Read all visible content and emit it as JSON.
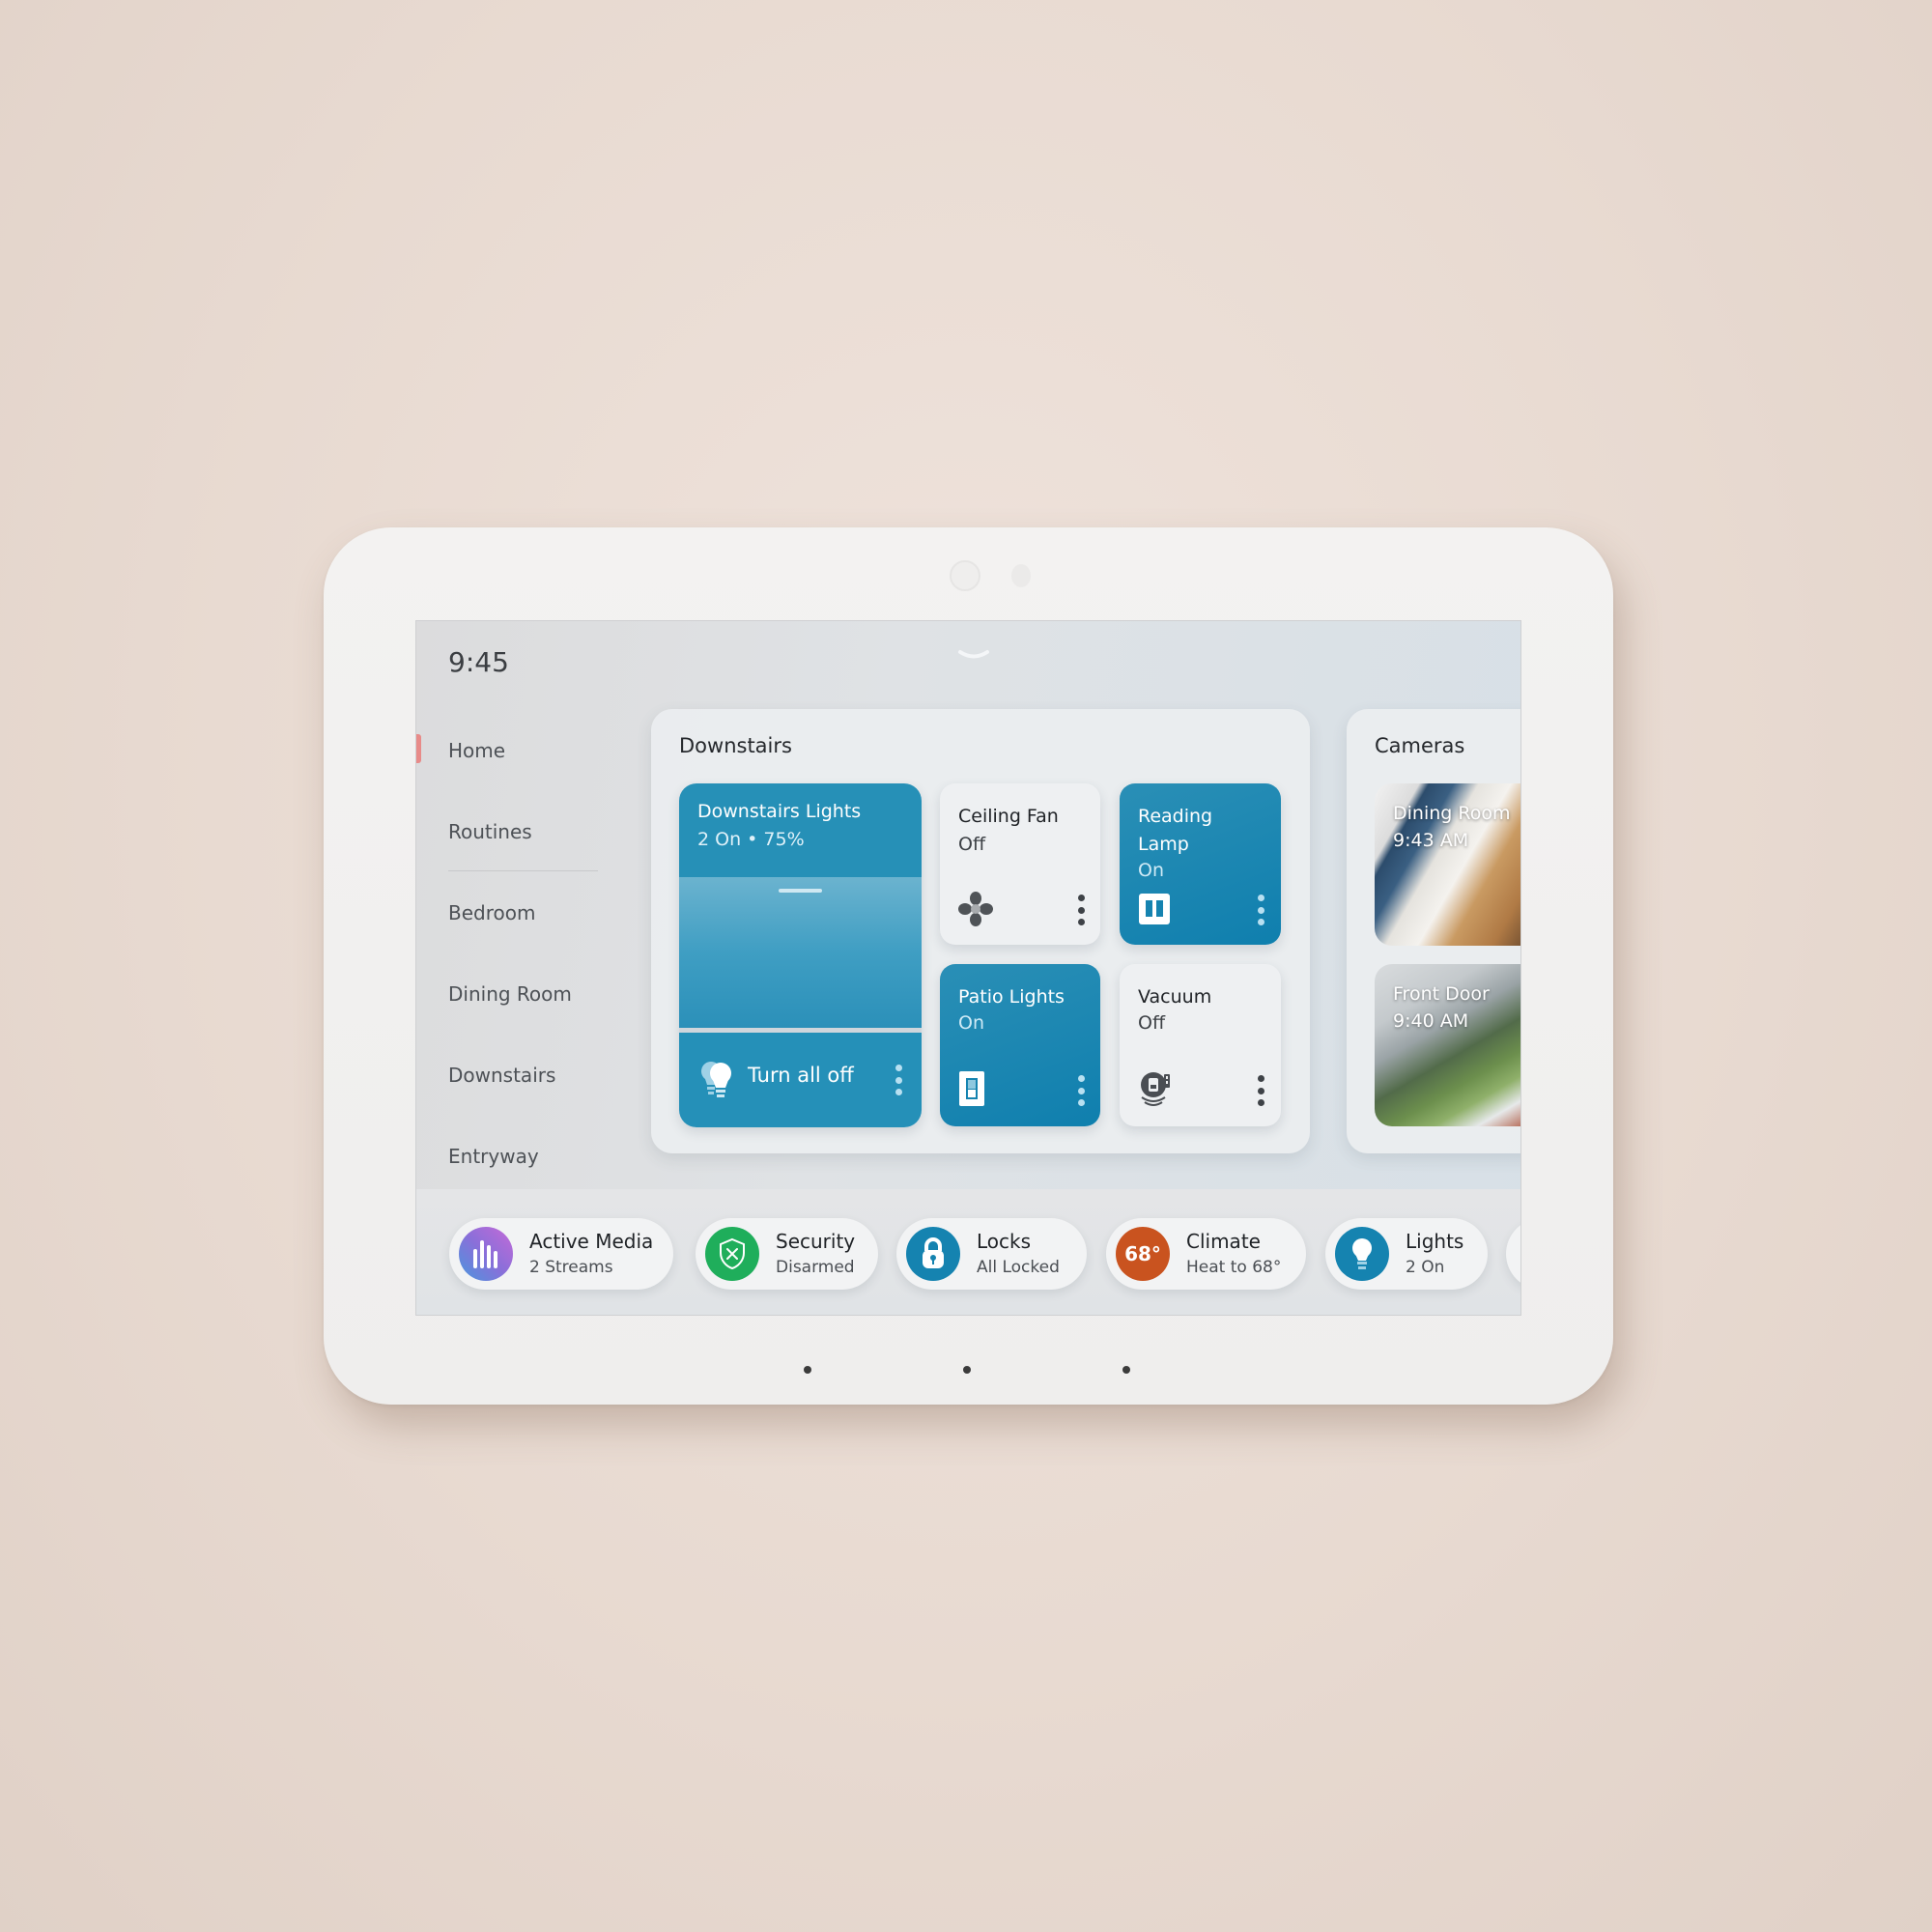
{
  "device": {
    "mic_dots": 3
  },
  "screen": {
    "clock": "9:45",
    "nav": {
      "active": "Home",
      "items": [
        {
          "label": "Home"
        },
        {
          "label": "Routines"
        },
        {
          "label": "Bedroom"
        },
        {
          "label": "Dining Room"
        },
        {
          "label": "Downstairs"
        },
        {
          "label": "Entryway"
        }
      ]
    },
    "downstairs": {
      "title": "Downstairs",
      "group": {
        "name": "Downstairs Lights",
        "summary": "2 On • 75%",
        "brightness_percent": 75,
        "action_label": "Turn all off",
        "icon": "light-bulbs-icon"
      },
      "devices": [
        {
          "name": "Ceiling Fan",
          "state": "Off",
          "on": false,
          "icon": "fan-icon"
        },
        {
          "name": "Reading Lamp",
          "state": "On",
          "on": true,
          "icon": "smart-plug-icon"
        },
        {
          "name": "Patio Lights",
          "state": "On",
          "on": true,
          "icon": "light-switch-icon"
        },
        {
          "name": "Vacuum",
          "state": "Off",
          "on": false,
          "icon": "robot-vacuum-icon"
        }
      ]
    },
    "cameras": {
      "title": "Cameras",
      "feeds": [
        {
          "name": "Dining Room",
          "time": "9:43 AM"
        },
        {
          "name": "Front Door",
          "time": "9:40 AM"
        }
      ]
    },
    "status_pills": [
      {
        "title": "Active Media",
        "subtitle": "2 Streams",
        "icon": "media-bars-icon",
        "color": "#9b6ad6"
      },
      {
        "title": "Security",
        "subtitle": "Disarmed",
        "icon": "shield-x-icon",
        "color": "#1fae5b"
      },
      {
        "title": "Locks",
        "subtitle": "All Locked",
        "icon": "padlock-icon",
        "color": "#1583b0"
      },
      {
        "title": "Climate",
        "subtitle": "Heat to 68°",
        "badge": "68°",
        "icon": "thermostat-badge",
        "color": "#c9531f"
      },
      {
        "title": "Lights",
        "subtitle": "2 On",
        "icon": "light-bulb-icon",
        "color": "#1583b0"
      }
    ]
  },
  "colors": {
    "accent_on": "#1583b0",
    "nav_indicator": "#e88b89"
  }
}
